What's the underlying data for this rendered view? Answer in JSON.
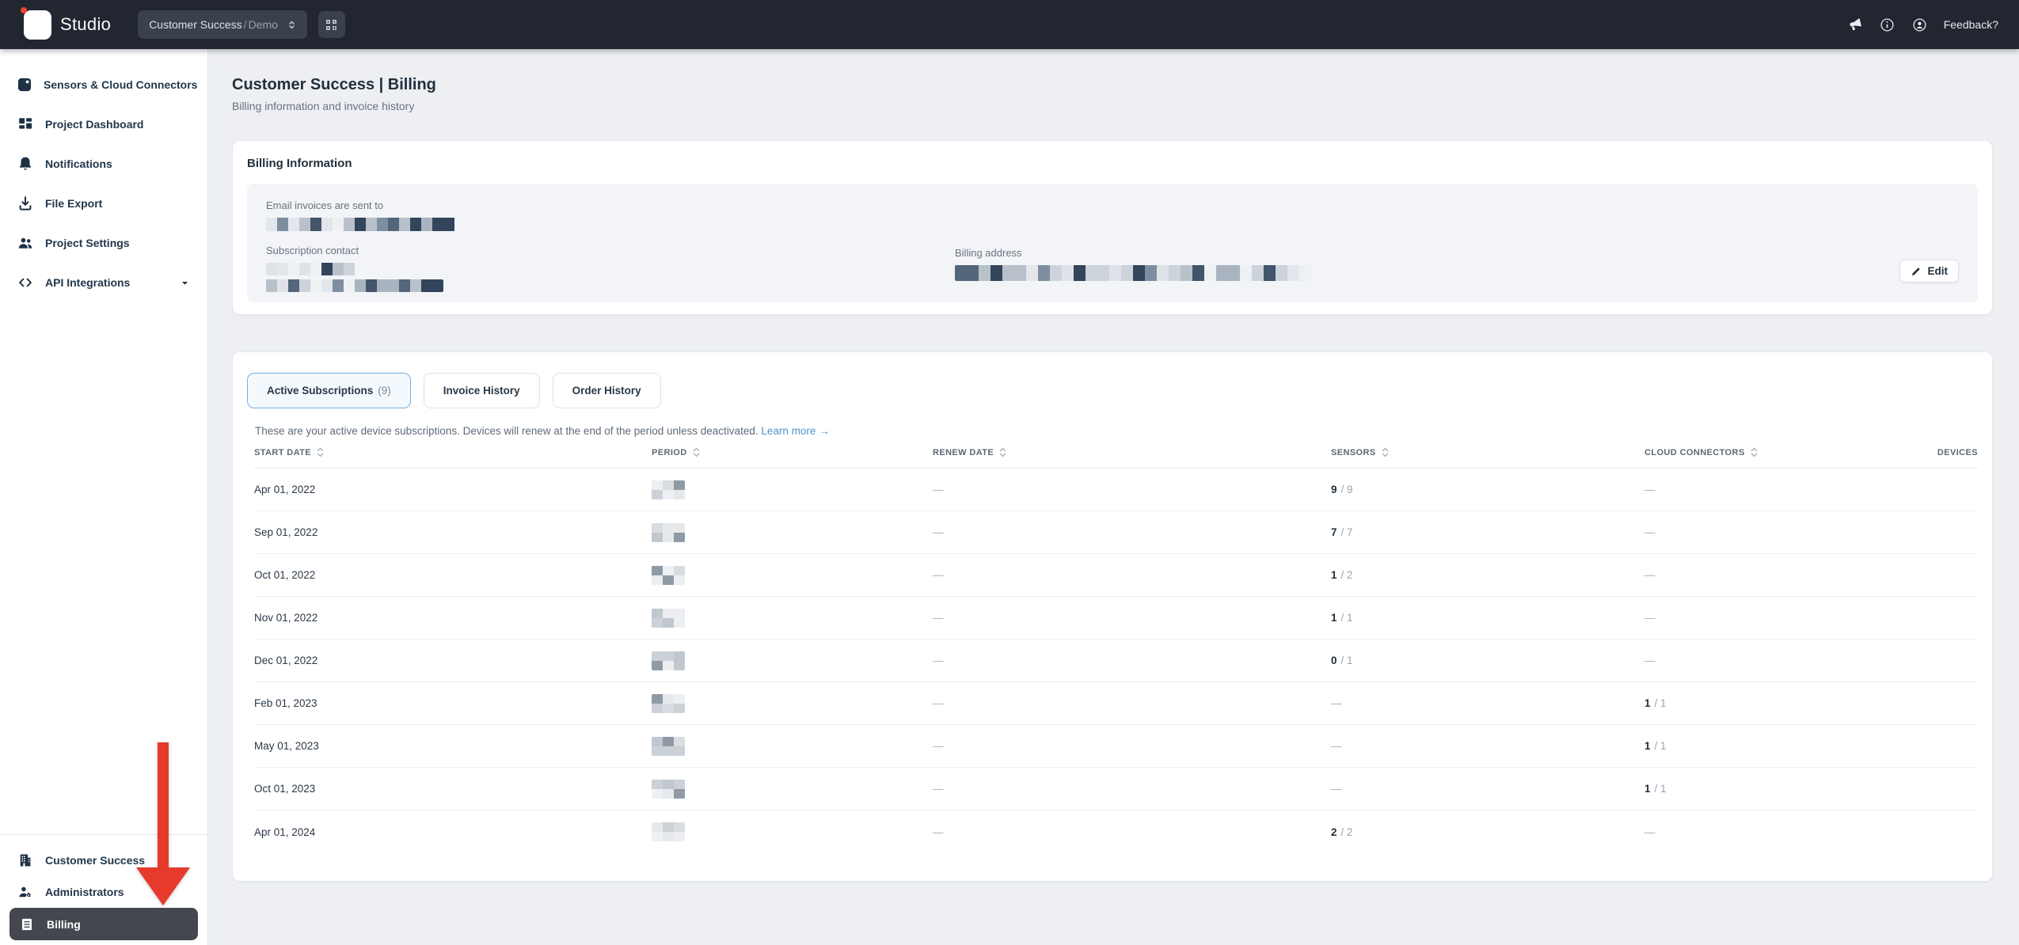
{
  "topbar": {
    "brand": "Studio",
    "selector": {
      "project": "Customer Success",
      "separator": "/",
      "env": "Demo"
    },
    "feedback_label": "Feedback?",
    "icons": [
      "megaphone-icon",
      "info-icon",
      "account-icon",
      "qr-scan-icon",
      "chevrons-updown-icon"
    ]
  },
  "sidebar": {
    "items": [
      {
        "label": "Sensors & Cloud Connectors",
        "icon": "sensor"
      },
      {
        "label": "Project Dashboard",
        "icon": "dashboard"
      },
      {
        "label": "Notifications",
        "icon": "bell"
      },
      {
        "label": "File Export",
        "icon": "download"
      },
      {
        "label": "Project Settings",
        "icon": "people"
      },
      {
        "label": "API Integrations",
        "icon": "code",
        "has_caret": true
      }
    ],
    "bottom_items": [
      {
        "label": "Customer Success",
        "icon": "building",
        "active": false
      },
      {
        "label": "Administrators",
        "icon": "admin",
        "active": false
      },
      {
        "label": "Billing",
        "icon": "billing",
        "active": true
      }
    ]
  },
  "page": {
    "title": "Customer Success | Billing",
    "subtitle": "Billing information and invoice history"
  },
  "billing_card": {
    "title": "Billing Information",
    "email_label": "Email invoices are sent to",
    "contact_label": "Subscription contact",
    "address_label": "Billing address",
    "edit_label": "Edit",
    "email_redacted": true,
    "contact_redacted": true,
    "address_redacted": true
  },
  "tabs": [
    {
      "label": "Active Subscriptions",
      "count": "(9)",
      "active": true
    },
    {
      "label": "Invoice History",
      "count": "",
      "active": false
    },
    {
      "label": "Order History",
      "count": "",
      "active": false
    }
  ],
  "subscriptions": {
    "description": "These are your active device subscriptions. Devices will renew at the end of the period unless deactivated.",
    "learn_more_label": "Learn more",
    "learn_more_arrow": "→",
    "table": {
      "columns": [
        {
          "label": "START DATE",
          "sortable": true
        },
        {
          "label": "PERIOD",
          "sortable": true
        },
        {
          "label": "RENEW DATE",
          "sortable": true
        },
        {
          "label": "SENSORS",
          "sortable": true
        },
        {
          "label": "CLOUD CONNECTORS",
          "sortable": true
        },
        {
          "label": "DEVICES",
          "sortable": false
        }
      ],
      "rows": [
        {
          "start_date": "Apr 01, 2022",
          "period_redacted": true,
          "renew_date": "—",
          "sensors_active": "9",
          "sensors_total": "9",
          "cloud_active": "",
          "cloud_total": "",
          "devices": ""
        },
        {
          "start_date": "Sep 01, 2022",
          "period_redacted": true,
          "renew_date": "—",
          "sensors_active": "7",
          "sensors_total": "7",
          "cloud_active": "",
          "cloud_total": "",
          "devices": ""
        },
        {
          "start_date": "Oct 01, 2022",
          "period_redacted": true,
          "renew_date": "—",
          "sensors_active": "1",
          "sensors_total": "2",
          "cloud_active": "",
          "cloud_total": "",
          "devices": ""
        },
        {
          "start_date": "Nov 01, 2022",
          "period_redacted": true,
          "renew_date": "—",
          "sensors_active": "1",
          "sensors_total": "1",
          "cloud_active": "",
          "cloud_total": "",
          "devices": ""
        },
        {
          "start_date": "Dec 01, 2022",
          "period_redacted": true,
          "renew_date": "—",
          "sensors_active": "0",
          "sensors_total": "1",
          "cloud_active": "",
          "cloud_total": "",
          "devices": ""
        },
        {
          "start_date": "Feb 01, 2023",
          "period_redacted": true,
          "renew_date": "—",
          "sensors_active": "",
          "sensors_total": "",
          "cloud_active": "1",
          "cloud_total": "1",
          "devices": ""
        },
        {
          "start_date": "May 01, 2023",
          "period_redacted": true,
          "renew_date": "—",
          "sensors_active": "",
          "sensors_total": "",
          "cloud_active": "1",
          "cloud_total": "1",
          "devices": ""
        },
        {
          "start_date": "Oct 01, 2023",
          "period_redacted": true,
          "renew_date": "—",
          "sensors_active": "",
          "sensors_total": "",
          "cloud_active": "1",
          "cloud_total": "1",
          "devices": ""
        },
        {
          "start_date": "Apr 01, 2024",
          "period_redacted": true,
          "renew_date": "—",
          "sensors_active": "2",
          "sensors_total": "2",
          "cloud_active": "",
          "cloud_total": "",
          "devices": ""
        }
      ]
    }
  },
  "annotation": {
    "type": "red-arrow",
    "points_to": "Billing"
  },
  "colors": {
    "topbar_bg": "#212630",
    "page_bg": "#edeff3",
    "sidebar_active_bg": "#44484e",
    "active_tab_border": "#79aedd",
    "active_tab_bg": "#f4f9fe",
    "link_blue": "#4f94c9",
    "annotation_red": "#e63a2c",
    "panel_bg": "#f2f4f7"
  }
}
